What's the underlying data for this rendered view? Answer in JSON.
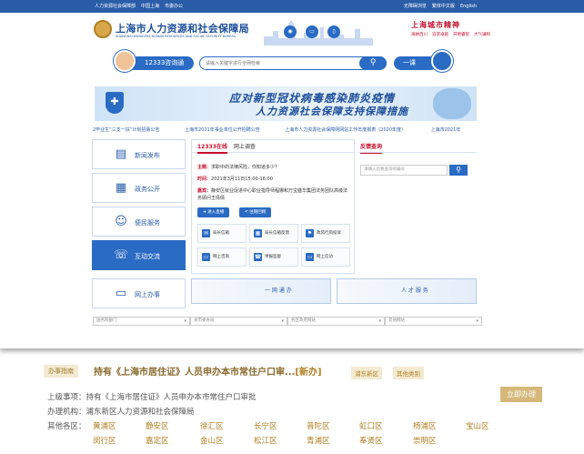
{
  "topbar": {
    "left_links": [
      "人力资源社会保障部",
      "中国上海",
      "市委办公"
    ],
    "right_links": [
      "无障碍浏览",
      "繁体中文版",
      "English"
    ]
  },
  "header": {
    "title": "上海市人力资源和社会保障局",
    "subtitle": "SHANGHAI MUNICIPAL HUMAN RESOURCES AND SOCIAL SECURITY BUREAU",
    "right_brand": "上海城市精神",
    "right_slogans": [
      "海纳百川",
      "追求卓越",
      "开明睿智",
      "大气谦和"
    ]
  },
  "search": {
    "hotline_label": "12333咨询通",
    "placeholder": "请输入关键字进行全网检索",
    "button_icon": "search-icon",
    "yike_label": "一课"
  },
  "banner": {
    "line1": "应对新型冠状病毒感染肺炎疫情",
    "line2": "人力资源社会保障支持保障措施"
  },
  "ticker": [
    "2毕业生“三支一扶”计划招募公告",
    "上海市2021年事业单位公开招聘公告",
    "上海市人力资源社会保障网网站工作年度报表（2020年度）",
    "上海市2021年"
  ],
  "nav": [
    {
      "label": "新闻发布",
      "icon": "news-icon"
    },
    {
      "label": "政务公开",
      "icon": "document-icon"
    },
    {
      "label": "便民服务",
      "icon": "user-icon"
    },
    {
      "label": "互动交流",
      "icon": "chat-icon"
    },
    {
      "label": "网上办事",
      "icon": "monitor-icon"
    }
  ],
  "panel": {
    "tab_active": "12333在线",
    "tab_other": "网上调查",
    "theme_label": "主题：",
    "theme_text": "求职中的法律风险，你知道多少？",
    "time_label": "时间：",
    "time_text": "2021年3月11日15:00-16:00",
    "guest_label": "嘉宾：",
    "guest_text": "静安区就业促进中心职业指导师程娜和万宝盛华集团法务团队高级法务顾问王倩倩",
    "btn_enter": "进入直播",
    "btn_review": "往期回顾",
    "services": [
      "局长信箱",
      "局长信箱反馈",
      "政风行风投诉",
      "网上咨询",
      "举报监督",
      "网上信访"
    ]
  },
  "right_panel": {
    "title": "反馈查询",
    "placeholder": "请输入您要查询的编号"
  },
  "strips": {
    "one_net": "一 网 通 办",
    "talent": "人 才 服 务"
  },
  "selects": [
    "国务院部门",
    "本市委办局",
    "各区政府网站",
    "其他网站"
  ],
  "below": {
    "tag": "办事指南",
    "headline": "持有《上海市居住证》人员申办本市常住户口审...",
    "new_label": "[新办]",
    "chip1": "浦东新区",
    "chip2": "其他类别",
    "superior_label": "上级事项：",
    "superior_value": "持有《上海市居住证》人员申办本市常住户口审批",
    "org_label": "办理机构：",
    "org_value": "浦东新区人力资源和社会保障局",
    "districts_label": "其他各区：",
    "districts_row1": [
      "黄浦区",
      "静安区",
      "徐汇区",
      "长宁区",
      "普陀区",
      "虹口区",
      "杨浦区",
      "宝山区"
    ],
    "districts_row2": [
      "闵行区",
      "嘉定区",
      "金山区",
      "松江区",
      "青浦区",
      "奉贤区",
      "崇明区"
    ],
    "apply_label": "立即办理"
  }
}
